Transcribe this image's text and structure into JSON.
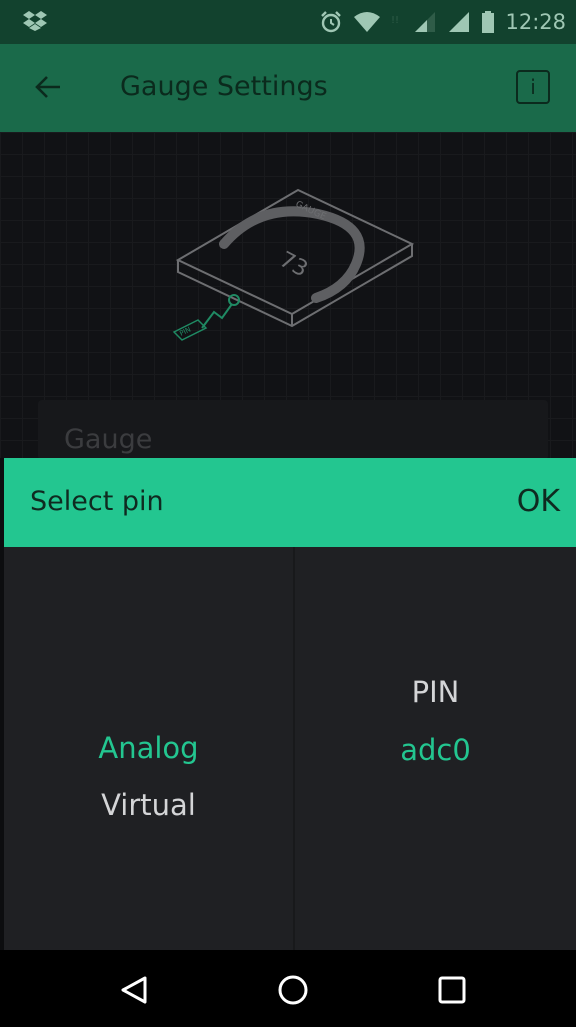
{
  "status_bar": {
    "time": "12:28"
  },
  "app_bar": {
    "title": "Gauge Settings",
    "info_label": "i"
  },
  "preview": {
    "gauge_label": "GAUGE",
    "gauge_value": "73",
    "pin_label": "PIN"
  },
  "name_field": {
    "value": "Gauge"
  },
  "dialog": {
    "title": "Select pin",
    "ok_label": "OK",
    "left_column": {
      "options": [
        {
          "label": "Analog",
          "selected": true
        },
        {
          "label": "Virtual",
          "selected": false
        }
      ]
    },
    "right_column": {
      "options": [
        {
          "label": "PIN",
          "selected": false
        },
        {
          "label": "adc0",
          "selected": true
        }
      ]
    }
  },
  "colors": {
    "accent": "#23c690",
    "app_bar": "#1a6a4a",
    "status_bar": "#12422e",
    "picker_background": "#1f2023"
  },
  "icons": {
    "status_left": "dropbox-icon",
    "status_right": [
      "alarm-icon",
      "wifi-icon",
      "sim-icon",
      "signal-icon",
      "signal-icon",
      "battery-icon"
    ],
    "nav": [
      "nav-back-icon",
      "nav-home-icon",
      "nav-recents-icon"
    ]
  }
}
